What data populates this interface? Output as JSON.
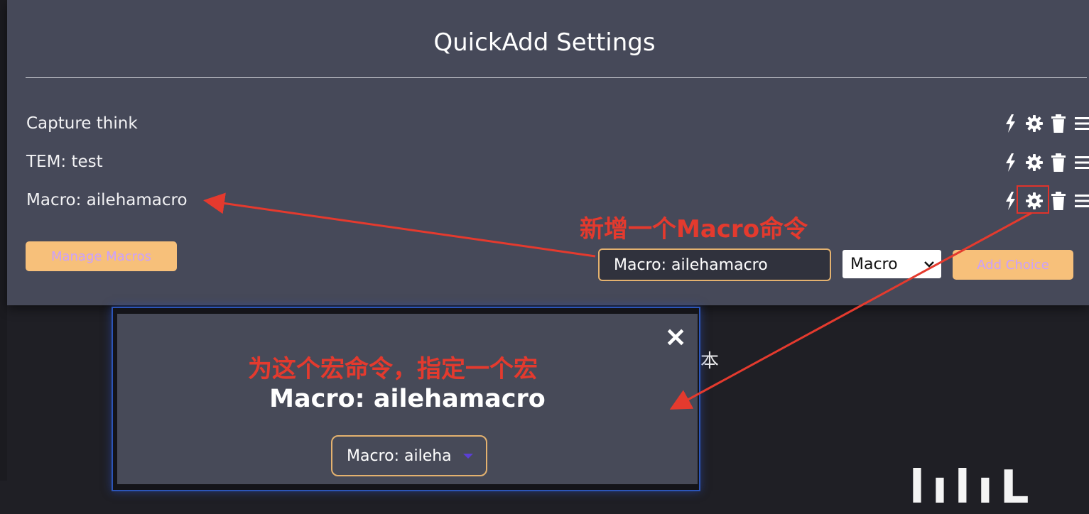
{
  "settings": {
    "title": "QuickAdd Settings",
    "choices": [
      {
        "label": "Capture think"
      },
      {
        "label": "TEM: test"
      },
      {
        "label": "Macro: ailehamacro"
      }
    ],
    "manage_macros_label": "Manage Macros",
    "new_choice": {
      "name_value": "Macro: ailehamacro",
      "type_value": "Macro",
      "add_choice_label": "Add Choice"
    }
  },
  "annotations": {
    "top": "新增一个Macro命令",
    "bottom": "为这个宏命令，指定一个宏"
  },
  "modal": {
    "close_symbol": "✕",
    "title": "Macro: ailehamacro",
    "select_value": "Macro: aileha"
  },
  "background": {
    "cjk_text": "本",
    "partial_text": "lılıL"
  },
  "colors": {
    "panel_bg": "#464959",
    "accent_button": "#f7c07a",
    "accent_button_text": "#c9a0ff",
    "annotation_red": "#e43a2e",
    "input_border": "#e4b26f"
  },
  "icons": [
    "lightning-icon",
    "gear-icon",
    "trash-icon",
    "drag-handle-icon"
  ]
}
